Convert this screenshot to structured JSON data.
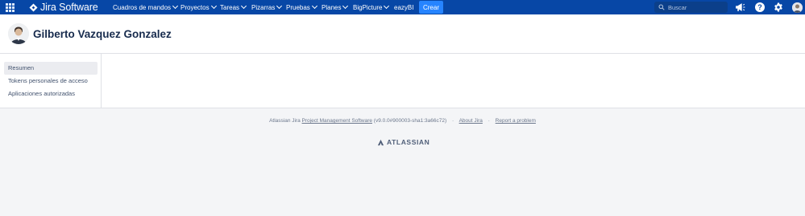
{
  "topnav": {
    "product_name": "Jira Software",
    "menu": [
      {
        "label": "Cuadros de mandos"
      },
      {
        "label": "Proyectos"
      },
      {
        "label": "Tareas"
      },
      {
        "label": "Pizarras"
      },
      {
        "label": "Pruebas"
      },
      {
        "label": "Planes"
      },
      {
        "label": "BigPicture"
      },
      {
        "label": "eazyBI"
      }
    ],
    "create_label": "Crear",
    "search_placeholder": "Buscar",
    "help_glyph": "?",
    "icons": [
      "app-switcher-icon",
      "jira-logo-icon",
      "search-icon",
      "megaphone-icon",
      "help-icon",
      "gear-icon",
      "avatar"
    ],
    "colors": {
      "nav_bg": "#0747a6",
      "create_bg": "#2684ff"
    }
  },
  "profile": {
    "name": "Gilberto Vazquez Gonzalez"
  },
  "sidebar": {
    "items": [
      {
        "label": "Resumen",
        "active": true
      },
      {
        "label": "Tokens personales de acceso",
        "active": false
      },
      {
        "label": "Aplicaciones autorizadas",
        "active": false
      }
    ]
  },
  "footer": {
    "prefix": "Atlassian Jira",
    "link_pms": "Project Management Software",
    "version": "(v9.0.0#900003-sha1:3a66c72)",
    "separator": "·",
    "link_about": "About Jira",
    "link_report": "Report a problem",
    "brand": "ATLASSIAN"
  }
}
